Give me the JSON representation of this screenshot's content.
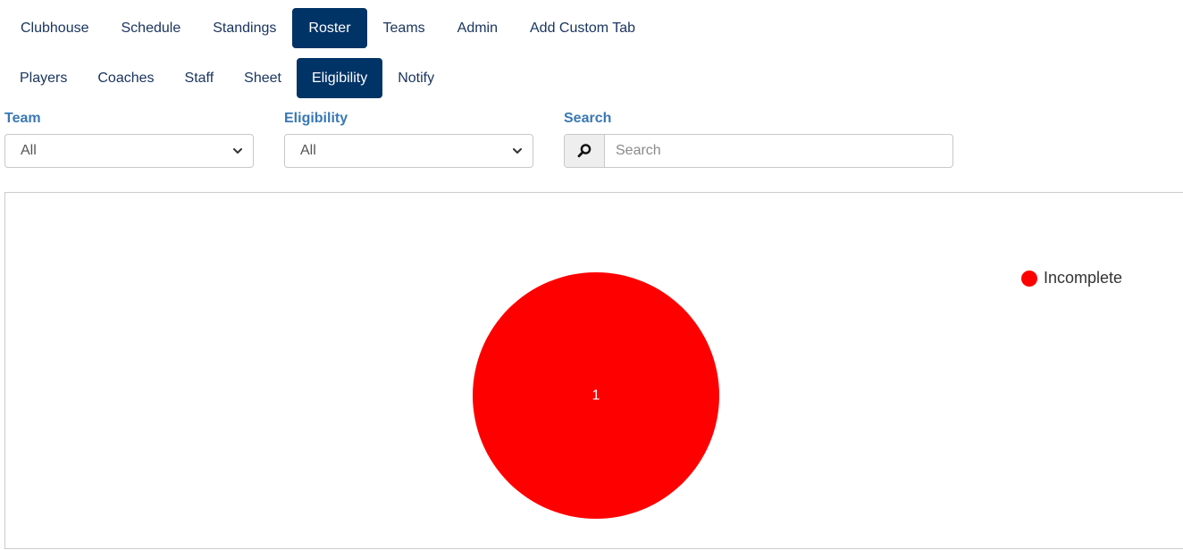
{
  "primary_nav": [
    {
      "label": "Clubhouse",
      "active": false
    },
    {
      "label": "Schedule",
      "active": false
    },
    {
      "label": "Standings",
      "active": false
    },
    {
      "label": "Roster",
      "active": true
    },
    {
      "label": "Teams",
      "active": false
    },
    {
      "label": "Admin",
      "active": false
    },
    {
      "label": "Add Custom Tab",
      "active": false
    }
  ],
  "secondary_nav": [
    {
      "label": "Players",
      "active": false
    },
    {
      "label": "Coaches",
      "active": false
    },
    {
      "label": "Staff",
      "active": false
    },
    {
      "label": "Sheet",
      "active": false
    },
    {
      "label": "Eligibility",
      "active": true
    },
    {
      "label": "Notify",
      "active": false
    }
  ],
  "filters": {
    "team": {
      "label": "Team",
      "value": "All"
    },
    "eligibility": {
      "label": "Eligibility",
      "value": "All"
    },
    "search": {
      "label": "Search",
      "placeholder": "Search",
      "value": ""
    }
  },
  "icons": {
    "search": "search-icon",
    "dropdown": "chevron-down-icon"
  },
  "colors": {
    "active_tab": "#003366",
    "filter_label": "#3a78b4"
  },
  "chart_data": {
    "type": "pie",
    "categories": [
      "Incomplete"
    ],
    "values": [
      1
    ],
    "colors": [
      "#ff0000"
    ],
    "data_labels": [
      "1"
    ],
    "legend_placement": "top-right"
  }
}
